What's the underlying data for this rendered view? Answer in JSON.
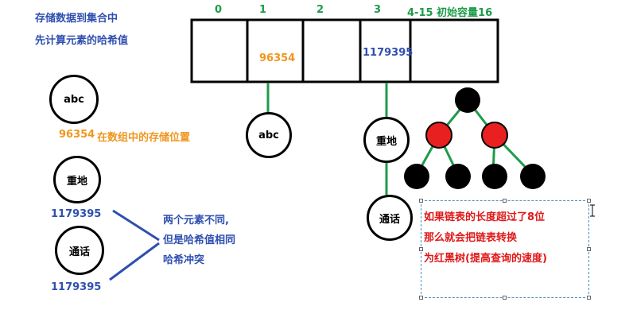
{
  "intro": {
    "line1": "存储数据到集合中",
    "line2": "先计算元素的哈希值"
  },
  "array": {
    "indices": [
      "0",
      "1",
      "2",
      "3",
      "4-15 初始容量16"
    ],
    "cells": [
      "",
      "96354",
      "",
      "1179395",
      ""
    ]
  },
  "chain_nodes": {
    "node_abc": "abc",
    "node_zhongdi": "重地",
    "node_tonghua": "通话"
  },
  "legend": {
    "abc": "abc",
    "abc_hash": "96354",
    "abc_hash_desc": "在数组中的存储位置",
    "zhongdi": "重地",
    "zhongdi_hash": "1179395",
    "tonghua": "通话",
    "tonghua_hash": "1179395"
  },
  "collision_note": {
    "line1": "两个元素不同,",
    "line2": "但是哈希值相同",
    "line3": "哈希冲突"
  },
  "tree_note": {
    "line1": "如果链表的长度超过了8位",
    "line2": "那么就会把链表转换",
    "line3": "为红黑树(提高查询的速度)"
  },
  "colors": {
    "blue": "#2f4fb0",
    "orange": "#f0961e",
    "green": "#1e9b4a",
    "red": "#e01818",
    "tree_red": "#e82020",
    "tree_black": "#000000"
  }
}
